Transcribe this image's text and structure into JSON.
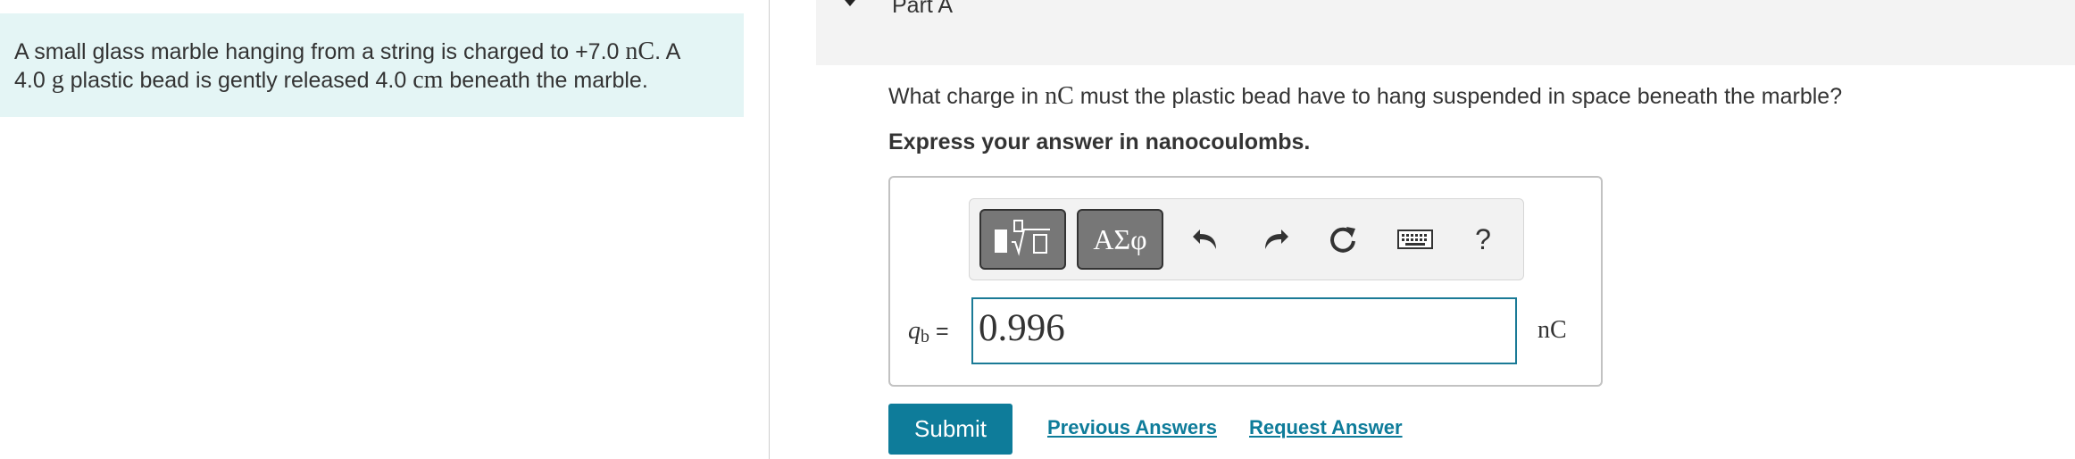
{
  "problem": {
    "line1_prefix": "A small glass marble hanging from a string is charged to +7.0 ",
    "line1_unit": "nC",
    "line1_suffix": ". A",
    "line2_prefix": "4.0 ",
    "line2_unit_g": "g",
    "line2_mid": " plastic bead is gently released 4.0 ",
    "line2_unit_cm": "cm",
    "line2_suffix": " beneath the marble."
  },
  "part": {
    "title": "Part A"
  },
  "question": {
    "prefix": "What charge in ",
    "unit": "nC",
    "suffix": " must the plastic bead have to hang suspended in space beneath the marble?",
    "instruction": "Express your answer in nanocoulombs."
  },
  "toolbar": {
    "greek_label": "ΑΣφ",
    "help_label": "?",
    "icons": [
      "templates-icon",
      "undo-icon",
      "redo-icon",
      "reset-icon",
      "keyboard-icon",
      "help-icon"
    ]
  },
  "answer": {
    "variable": "q",
    "subscript": "b",
    "equals": "=",
    "value": "0.996",
    "unit": "nC"
  },
  "actions": {
    "submit_label": "Submit",
    "previous_answers_label": "Previous Answers",
    "request_answer_label": "Request Answer"
  },
  "colors": {
    "accent": "#0e7c9a",
    "problem_bg": "#e4f5f5",
    "header_bg": "#f3f3f3"
  }
}
